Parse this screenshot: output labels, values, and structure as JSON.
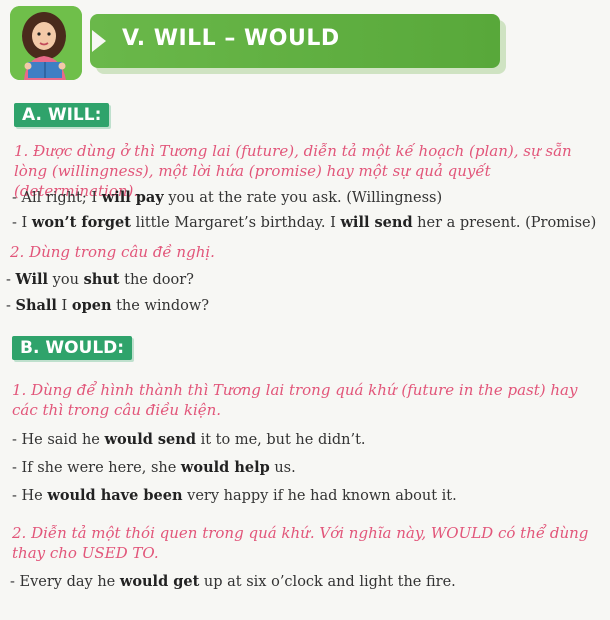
{
  "header": {
    "title": "V. WILL – WOULD"
  },
  "sectionA": {
    "label": "A. WILL:",
    "rule1": "1. Được dùng ở thì Tương lai (future), diễn tả một kế hoạch (plan), sự sẵn lòng (willingness), một lời hứa (promise) hay một sự quả quyết (determination).",
    "examples1": [
      {
        "pre": "- All right; I ",
        "bold": "will pay",
        "post": " you at the rate you ask. (Willingness)"
      },
      {
        "pre": "- I ",
        "bold": "won’t forget",
        "mid": " little Margaret’s birthday. I ",
        "bold2": "will send",
        "post": " her a present. (Promise)"
      }
    ],
    "rule2": "2. Dùng trong câu đề nghị.",
    "examples2": [
      {
        "pre": "- ",
        "bold": "Will",
        "mid": " you ",
        "bold2": "shut",
        "post": " the door?"
      },
      {
        "pre": "- ",
        "bold": "Shall",
        "mid": " I ",
        "bold2": "open",
        "post": " the window?"
      }
    ]
  },
  "sectionB": {
    "label": "B. WOULD:",
    "rule1": "1. Dùng để hình thành thì Tương lai trong quá khứ (future in the past) hay các thì trong câu điều kiện.",
    "examples1": [
      {
        "pre": "- He said he ",
        "bold": "would send",
        "post": " it to me, but he didn’t."
      },
      {
        "pre": "- If she were here, she ",
        "bold": "would help",
        "post": " us."
      },
      {
        "pre": "- He ",
        "bold": "would have been",
        "post": " very happy if he had known about it."
      }
    ],
    "rule2": "2. Diễn tả một thói quen trong quá khứ. Với nghĩa này, WOULD có thể dùng thay cho USED TO.",
    "examples2": [
      {
        "pre": "- Every day he ",
        "bold": "would get",
        "post": " up at six o’clock and light the fire."
      }
    ]
  }
}
